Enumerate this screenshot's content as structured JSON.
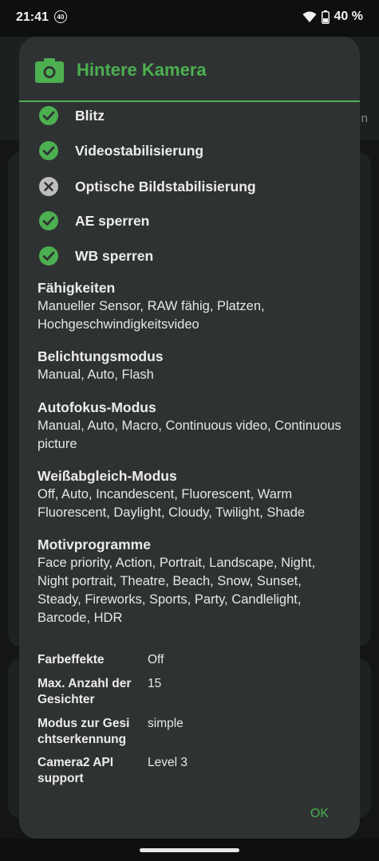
{
  "status_bar": {
    "time": "21:41",
    "badge": "40",
    "battery_percent": "40 %",
    "icons": [
      "wifi-icon",
      "battery-icon"
    ]
  },
  "background": {
    "tab_fragment": "n"
  },
  "dialog": {
    "title": "Hintere Kamera",
    "title_icon": "camera-icon",
    "accent_color": "#4caf50",
    "features": [
      {
        "label": "Blitz",
        "supported": true
      },
      {
        "label": "Videostabilisierung",
        "supported": true
      },
      {
        "label": "Optische Bildstabilisierung",
        "supported": false
      },
      {
        "label": "AE sperren",
        "supported": true
      },
      {
        "label": "WB sperren",
        "supported": true
      }
    ],
    "sections": [
      {
        "heading": "Fähigkeiten",
        "value": "Manueller Sensor, RAW fähig, Platzen, Hochgeschwindigkeitsvideo"
      },
      {
        "heading": "Belichtungsmodus",
        "value": "Manual, Auto, Flash"
      },
      {
        "heading": "Autofokus-Modus",
        "value": "Manual, Auto, Macro, Continuous video, Continuous picture"
      },
      {
        "heading": "Weißabgleich-Modus",
        "value": "Off, Auto, Incandescent, Fluorescent, Warm Fluorescent, Daylight, Cloudy, Twilight, Shade"
      },
      {
        "heading": "Motivprogramme",
        "value": "Face priority, Action, Portrait, Landscape, Night, Night portrait, Theatre, Beach, Snow, Sunset, Steady, Fireworks, Sports, Party, Candlelight, Barcode, HDR"
      }
    ],
    "properties": [
      {
        "key": "Farbeffekte",
        "value": "Off"
      },
      {
        "key": "Max. Anzahl der Gesichter",
        "value": "15"
      },
      {
        "key": "Modus zur Gesi chtserkennung",
        "value": "simple"
      },
      {
        "key": "Camera2 API support",
        "value": "Level 3"
      }
    ],
    "ok_label": "OK"
  }
}
